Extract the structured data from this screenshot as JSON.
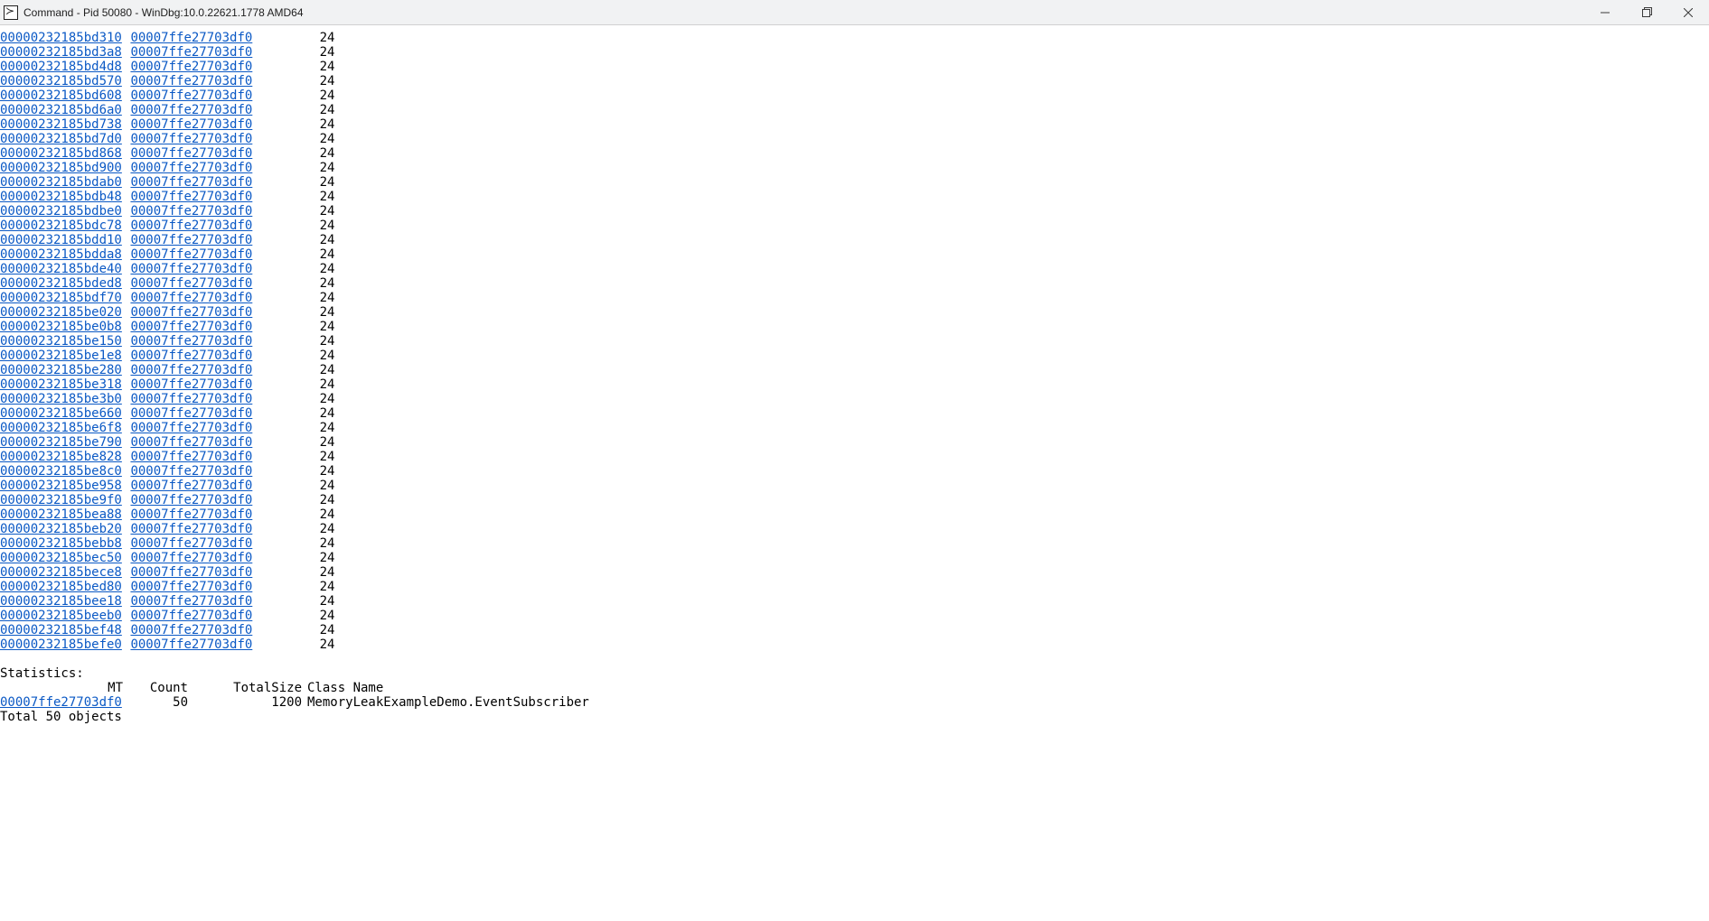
{
  "window": {
    "title": "Command - Pid 50080 - WinDbg:10.0.22621.1778 AMD64"
  },
  "output": {
    "methodTable": "00007ffe27703df0",
    "size": "24",
    "addresses": [
      "00000232185bd310",
      "00000232185bd3a8",
      "00000232185bd4d8",
      "00000232185bd570",
      "00000232185bd608",
      "00000232185bd6a0",
      "00000232185bd738",
      "00000232185bd7d0",
      "00000232185bd868",
      "00000232185bd900",
      "00000232185bdab0",
      "00000232185bdb48",
      "00000232185bdbe0",
      "00000232185bdc78",
      "00000232185bdd10",
      "00000232185bdda8",
      "00000232185bde40",
      "00000232185bded8",
      "00000232185bdf70",
      "00000232185be020",
      "00000232185be0b8",
      "00000232185be150",
      "00000232185be1e8",
      "00000232185be280",
      "00000232185be318",
      "00000232185be3b0",
      "00000232185be660",
      "00000232185be6f8",
      "00000232185be790",
      "00000232185be828",
      "00000232185be8c0",
      "00000232185be958",
      "00000232185be9f0",
      "00000232185bea88",
      "00000232185beb20",
      "00000232185bebb8",
      "00000232185bec50",
      "00000232185bece8",
      "00000232185bed80",
      "00000232185bee18",
      "00000232185beeb0",
      "00000232185bef48",
      "00000232185befe0"
    ],
    "stats": {
      "label": "Statistics:",
      "header": {
        "mt": "MT",
        "count": "Count",
        "total": "TotalSize",
        "class": "Class Name"
      },
      "row": {
        "mt": "00007ffe27703df0",
        "count": "50",
        "total": "1200",
        "class": "MemoryLeakExampleDemo.EventSubscriber"
      },
      "totalLine": "Total 50 objects"
    }
  }
}
